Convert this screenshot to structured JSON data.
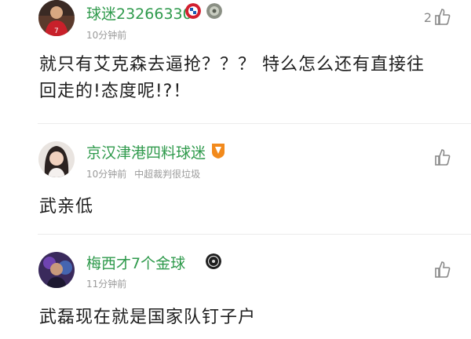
{
  "comments": [
    {
      "username": "球迷23266330",
      "time": "10分钟前",
      "reply_to": "",
      "likes": "2",
      "text_lines": [
        "就只有艾克森去逼抢？？？ 特么怎么还有直接往",
        "回走的!态度呢!?！"
      ],
      "badges": [
        "bayern-badge-icon",
        "team-badge-icon"
      ]
    },
    {
      "username": "京汉津港四料球迷",
      "time": "10分钟前",
      "reply_to": "中超裁判很垃圾",
      "likes": "",
      "text_lines": [
        "武亲低"
      ],
      "badges": [
        "shandong-badge-icon"
      ]
    },
    {
      "username": "梅西才7个金球",
      "time": "11分钟前",
      "reply_to": "",
      "likes": "",
      "text_lines": [
        "武磊现在就是国家队钉子户"
      ],
      "badges": [
        "team-badge-icon"
      ]
    }
  ],
  "colors": {
    "username": "#2f9a4c",
    "meta": "#9a9a9a",
    "text": "#1e1e1e",
    "divider": "#ececec"
  }
}
